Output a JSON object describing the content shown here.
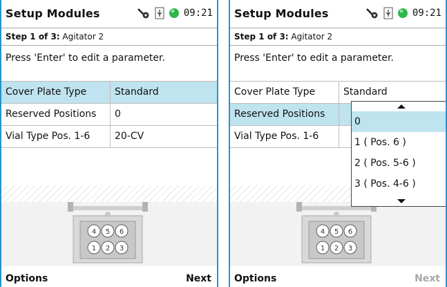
{
  "screens": [
    {
      "title": "Setup Modules",
      "time": "09:21",
      "step_bold": "Step 1 of 3:",
      "step_text": " Agitator 2",
      "instruction": "Press 'Enter' to edit a parameter.",
      "rows": [
        {
          "key": "Cover Plate Type",
          "value": "Standard"
        },
        {
          "key": "Reserved Positions",
          "value": "0"
        },
        {
          "key": "Vial Type Pos. 1-6",
          "value": "20-CV"
        }
      ],
      "footer": {
        "options": "Options",
        "next": "Next"
      }
    },
    {
      "title": "Setup Modules",
      "time": "09:21",
      "step_bold": "Step 1 of 3:",
      "step_text": " Agitator 2",
      "instruction": "Press 'Enter' to edit a parameter.",
      "rows": [
        {
          "key": "Cover Plate Type",
          "value": "Standard"
        },
        {
          "key": "Reserved Positions",
          "value": ""
        },
        {
          "key": "Vial Type Pos. 1-6",
          "value": ""
        }
      ],
      "dropdown": {
        "options": [
          "0",
          "1 ( Pos. 6 )",
          "2 ( Pos. 5-6 )",
          "3 ( Pos. 4-6 )"
        ],
        "selected": "0"
      },
      "footer": {
        "options": "Options",
        "next": "Next"
      }
    }
  ],
  "vial_numbers": [
    "4",
    "5",
    "6",
    "1",
    "2",
    "3"
  ],
  "colors": {
    "frame": "#2a93c7",
    "selection": "#bfe3ef",
    "status_led": "#2fb54a",
    "disabled_text": "#a7a7a7"
  },
  "icons": [
    "key-icon",
    "usb-icon",
    "status-led-icon",
    "scroll-up-arrow-icon",
    "scroll-down-arrow-icon"
  ]
}
